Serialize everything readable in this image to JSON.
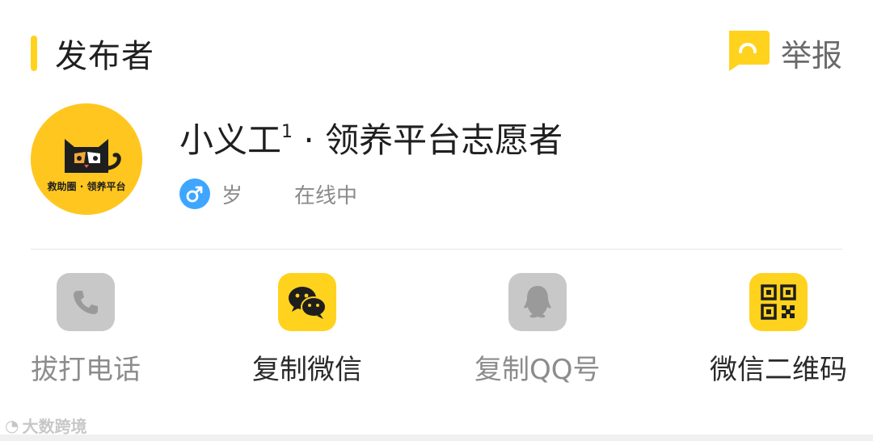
{
  "header": {
    "title": "发布者",
    "report_label": "举报"
  },
  "publisher": {
    "name": "小义工",
    "name_sup": "1",
    "name_suffix": " · 领养平台志愿者",
    "avatar_caption": "救助圈 · 领养平台",
    "gender_icon": "male-icon",
    "age_label": "岁",
    "status": "在线中"
  },
  "actions": [
    {
      "label": "拔打电话",
      "icon": "phone-icon",
      "enabled": false
    },
    {
      "label": "复制微信",
      "icon": "wechat-icon",
      "enabled": true
    },
    {
      "label": "复制QQ号",
      "icon": "qq-icon",
      "enabled": false
    },
    {
      "label": "微信二维码",
      "icon": "qr-code-icon",
      "enabled": true
    }
  ],
  "watermark": {
    "text": "大数跨境"
  },
  "colors": {
    "accent": "#ffd21e",
    "disabled_icon_bg": "#c8c8c8",
    "gender_male": "#3ea6ff"
  }
}
